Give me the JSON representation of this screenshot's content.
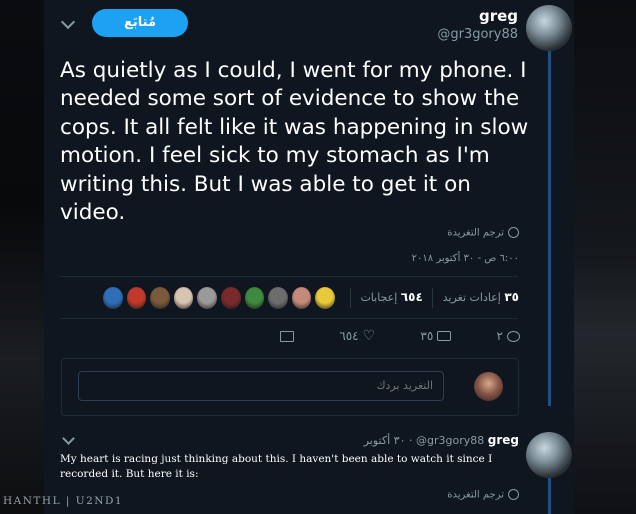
{
  "author": {
    "name": "greg",
    "handle": "@gr3gory88",
    "follow_label": "مُتابَع"
  },
  "tweet": {
    "text": "As quietly as I could, I went for my phone. I needed some sort of evidence to show the cops. It all felt like it was happening in slow motion. I feel sick to my stomach as I'm writing this. But I was able to get it on video.",
    "translate_label": "ترجم التغريدة",
    "timestamp": "٦:٠٠ ص - ٣٠ أكتوبر ٢٠١٨"
  },
  "stats": {
    "retweets_count": "٣٥",
    "retweets_label": "إعادات تغريد",
    "likes_count": "٦٥٤",
    "likes_label": "إعجابات"
  },
  "likers": [
    {
      "name": "liker-avatar",
      "color": "#e8c93a"
    },
    {
      "name": "liker-avatar",
      "color": "#c48a7a"
    },
    {
      "name": "liker-avatar",
      "color": "#6d6d6d"
    },
    {
      "name": "liker-avatar",
      "color": "#3e8a3e"
    },
    {
      "name": "liker-avatar",
      "color": "#7a2a2a"
    },
    {
      "name": "liker-avatar",
      "color": "#9a9a9a"
    },
    {
      "name": "liker-avatar",
      "color": "#d8c2b0"
    },
    {
      "name": "liker-avatar",
      "color": "#7a5a3a"
    },
    {
      "name": "liker-avatar",
      "color": "#c0392b"
    },
    {
      "name": "liker-avatar",
      "color": "#2e6fb8"
    }
  ],
  "actions": {
    "reply_count": "٢",
    "retweet_count": "٣٥",
    "like_count": "٦٥٤"
  },
  "reply_box": {
    "placeholder": "التغريد بردك"
  },
  "reply": {
    "name": "greg",
    "handle": "@gr3gory88",
    "date": "٣٠ أكتوبر",
    "text": "My heart is racing just thinking about this. I haven't been able to watch it since I recorded it. But here it is:",
    "translate_label": "ترجم التغريدة"
  },
  "watermark": "HANTHL | U2ND1",
  "colors": {
    "accent": "#1da1f2",
    "panel": "#0f161f",
    "muted": "#8899a6",
    "thread": "#1d4f82"
  }
}
